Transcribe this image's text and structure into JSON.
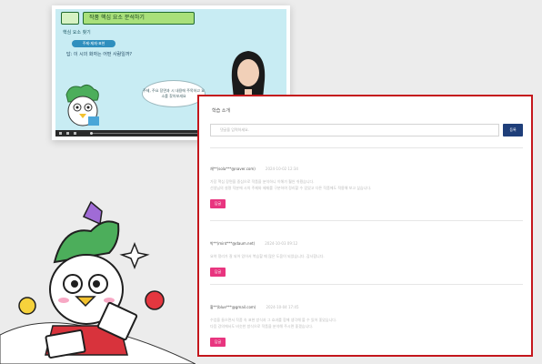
{
  "video": {
    "lesson_title": "작품 핵심 요소 분석하기",
    "question": "핵심 요소 찾기",
    "pill": "주제·제재·표현",
    "line": "답: 이 시의 화자는 어떤 사람일까?",
    "bubble": "주제, 주요 장면과 시 내용에 주목하고 요소를 찾아보세요",
    "note": "핵심 요소 작품 : 분석하기"
  },
  "panel": {
    "title": "학습 소개",
    "input_placeholder": "댓글을 입력하세요.",
    "submit_label": "등록",
    "comments": [
      {
        "author": "채**(sola***@naver.com)",
        "date": "2024-10-02 12:34",
        "text1": "가장 핵심 장면을 중심으로 작품을 분석하니 이해가 훨씬 쉬웠습니다.",
        "text2": "선생님의 설명 덕분에 시의 주제와 제재를 구분하여 정리할 수 있었고 다른 작품에도 적용해 보고 싶습니다.",
        "reply_label": "답글"
      },
      {
        "author": "박**(mint***@daum.net)",
        "date": "2024-10-03 09:12",
        "text1": "요약 정리가 잘 되어 있어서 복습할 때 많은 도움이 되었습니다. 감사합니다.",
        "text2": "",
        "reply_label": "답글"
      },
      {
        "author": "황**(blue***@gmail.com)",
        "date": "2024-10-04 17:45",
        "text1": "수업을 들으면서 작품 속 표현 방식과 그 효과를 함께 생각해 볼 수 있어 좋았습니다.",
        "text2": "다음 강의에서도 비슷한 방식으로 작품을 분석해 주시면 좋겠습니다.",
        "reply_label": "답글"
      }
    ]
  },
  "colors": {
    "accent_red": "#c4161c",
    "submit_navy": "#1f3f7a",
    "reply_pink": "#e8357f"
  }
}
